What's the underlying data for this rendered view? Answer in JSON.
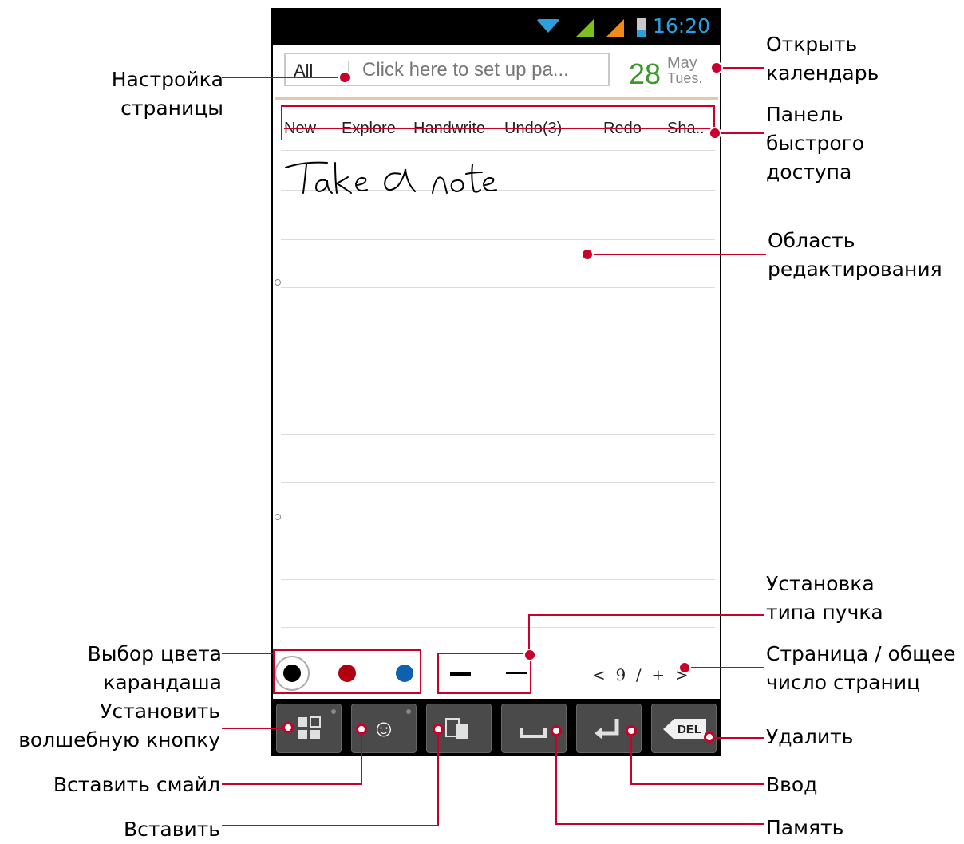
{
  "status_bar": {
    "time": "16:20"
  },
  "header": {
    "category": "All",
    "page_placeholder": "Click here to set up pa...",
    "date_day": "28",
    "date_month": "May",
    "date_weekday": "Tues."
  },
  "quick_bar": [
    "New",
    "Explore",
    "Handwrite",
    "Undo(3)",
    "Redo",
    "Sha.."
  ],
  "note": {
    "handwritten_text": "Take a note"
  },
  "pen_colors": [
    "#000000",
    "#b00010",
    "#1060b0"
  ],
  "pager": {
    "text": "<  9  /  +  >"
  },
  "keys": {
    "magic_label": "",
    "del_label": "DEL"
  },
  "annotations": {
    "page_setup": [
      "Настройка",
      "страницы"
    ],
    "open_calendar": [
      "Открыть",
      "календарь"
    ],
    "quick_access": [
      "Панель",
      "быстрого",
      "доступа"
    ],
    "edit_area": [
      "Область",
      "редактирования"
    ],
    "pen_type": [
      "Установка",
      "типа пучка"
    ],
    "pen_color": [
      "Выбор цвета",
      "карандаша"
    ],
    "page_count": [
      "Страница / общее",
      "число страниц"
    ],
    "magic_button": [
      "Установить",
      "волшебную кнопку"
    ],
    "delete": "Удалить",
    "insert_smiley": "Вставить смайл",
    "enter": "Ввод",
    "paste": "Вставить",
    "memory": "Память"
  }
}
